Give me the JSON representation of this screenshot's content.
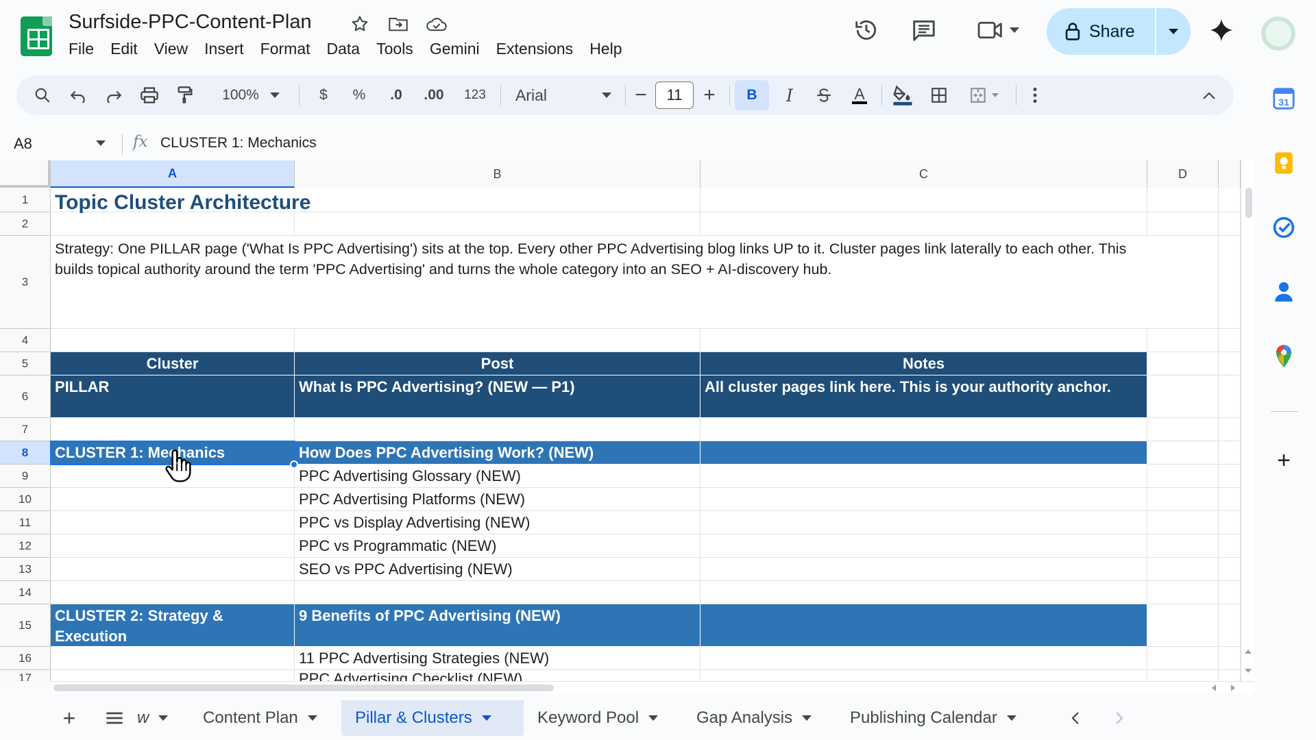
{
  "app": {
    "doc_title": "Surfside-PPC-Content-Plan",
    "menu": [
      "File",
      "Edit",
      "View",
      "Insert",
      "Format",
      "Data",
      "Tools",
      "Gemini",
      "Extensions",
      "Help"
    ],
    "share_label": "Share"
  },
  "toolbar": {
    "zoom": "100%",
    "currency": "$",
    "percent": "%",
    "dec_decrease": ".0",
    "dec_increase": ".00",
    "number_format": "123",
    "font": "Arial",
    "font_size": "11",
    "bold": "B",
    "italic": "I",
    "text_color": "A"
  },
  "formula_bar": {
    "cell_ref": "A8",
    "fx": "fx",
    "content": "CLUSTER 1: Mechanics"
  },
  "columns": [
    "A",
    "B",
    "C",
    "D"
  ],
  "rows": [
    {
      "n": "1"
    },
    {
      "n": "2"
    },
    {
      "n": "3"
    },
    {
      "n": "4"
    },
    {
      "n": "5"
    },
    {
      "n": "6"
    },
    {
      "n": "7"
    },
    {
      "n": "8"
    },
    {
      "n": "9"
    },
    {
      "n": "10"
    },
    {
      "n": "11"
    },
    {
      "n": "12"
    },
    {
      "n": "13"
    },
    {
      "n": "14"
    },
    {
      "n": "15"
    },
    {
      "n": "16"
    },
    {
      "n": "17"
    }
  ],
  "sheet": {
    "title": "Topic Cluster Architecture",
    "strategy": "Strategy: One PILLAR page ('What Is PPC Advertising') sits at the top. Every other PPC Advertising blog links UP to it. Cluster pages link laterally to each other. This builds topical authority around the term 'PPC Advertising' and turns the whole category into an SEO + AI-discovery hub.",
    "headers": {
      "cluster": "Cluster",
      "post": "Post",
      "notes": "Notes"
    },
    "pillar": {
      "cluster": "PILLAR",
      "post": "What Is PPC Advertising? (NEW — P1)",
      "notes": "All cluster pages link here. This is your authority anchor."
    },
    "cluster1": {
      "cluster": "CLUSTER 1: Mechanics",
      "post": "How Does PPC Advertising Work? (NEW)",
      "posts": [
        "PPC Advertising Glossary (NEW)",
        "PPC Advertising Platforms (NEW)",
        "PPC vs Display Advertising (NEW)",
        "PPC vs Programmatic (NEW)",
        "SEO vs PPC Advertising (NEW)"
      ]
    },
    "cluster2": {
      "cluster": "CLUSTER 2: Strategy & Execution",
      "post": "9 Benefits of PPC Advertising (NEW)",
      "posts": [
        "11 PPC Advertising Strategies (NEW)",
        "PPC Advertising Checklist (NEW)"
      ]
    }
  },
  "tabs": {
    "partial": "w",
    "items": [
      "Content Plan",
      "Pillar & Clusters",
      "Keyword Pool",
      "Gap Analysis",
      "Publishing Calendar"
    ],
    "active": "Pillar & Clusters"
  },
  "colors": {
    "header_dark": "#1f4e79",
    "cluster_blue": "#2e75b6",
    "accent": "#0b57d0",
    "share_bg": "#c2e7ff"
  }
}
